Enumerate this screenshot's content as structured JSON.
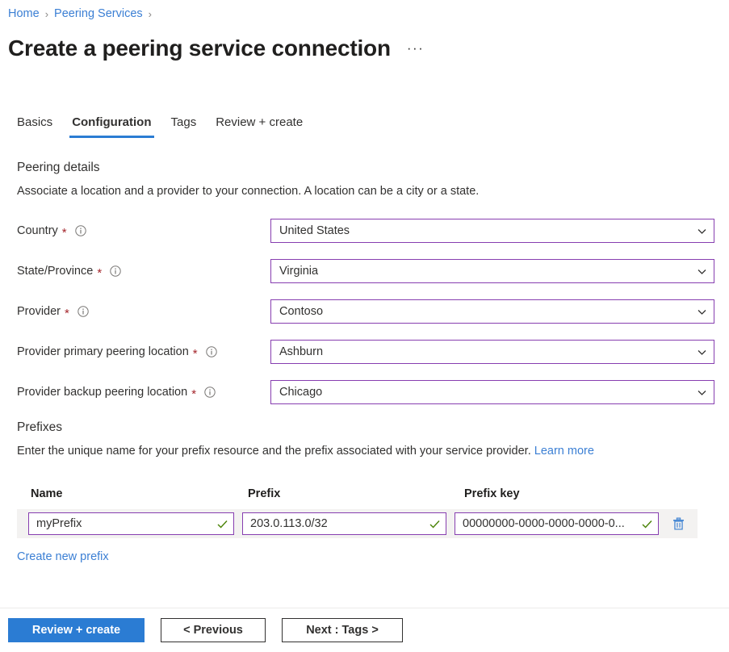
{
  "breadcrumb": {
    "items": [
      {
        "label": "Home"
      },
      {
        "label": "Peering Services"
      }
    ],
    "separator": "›"
  },
  "header": {
    "title": "Create a peering service connection",
    "more_menu": "···"
  },
  "tabs": [
    {
      "label": "Basics",
      "active": false
    },
    {
      "label": "Configuration",
      "active": true
    },
    {
      "label": "Tags",
      "active": false
    },
    {
      "label": "Review + create",
      "active": false
    }
  ],
  "peering_details": {
    "heading": "Peering details",
    "description": "Associate a location and a provider to your connection. A location can be a city or a state.",
    "required_marker": "*",
    "fields": [
      {
        "label": "Country",
        "required": true,
        "info": "info-icon",
        "value": "United States"
      },
      {
        "label": "State/Province",
        "required": true,
        "info": "info-icon",
        "value": "Virginia"
      },
      {
        "label": "Provider",
        "required": true,
        "info": "info-icon",
        "value": "Contoso"
      },
      {
        "label": "Provider primary peering location",
        "required": true,
        "info": "info-icon",
        "value": "Ashburn"
      },
      {
        "label": "Provider backup peering location",
        "required": true,
        "info": "info-icon",
        "value": "Chicago"
      }
    ]
  },
  "prefixes": {
    "heading": "Prefixes",
    "description": "Enter the unique name for your prefix resource and the prefix associated with your service provider.",
    "learn_more": "Learn more",
    "columns": [
      "Name",
      "Prefix",
      "Prefix key"
    ],
    "rows": [
      {
        "name": "myPrefix",
        "prefix": "203.0.113.0/32",
        "prefix_key": "00000000-0000-0000-0000-0...",
        "name_valid": true,
        "prefix_valid": true,
        "key_valid": true
      }
    ],
    "create_link": "Create new prefix"
  },
  "footer": {
    "review_create": "Review + create",
    "previous": "< Previous",
    "next": "Next : Tags >"
  },
  "colors": {
    "accent_blue": "#2b7cd3",
    "link_blue": "#3b7fd4",
    "input_border_purple": "#873eb0",
    "required_red": "#a4262c",
    "valid_green": "#498205",
    "row_background": "#f3f2f1"
  }
}
